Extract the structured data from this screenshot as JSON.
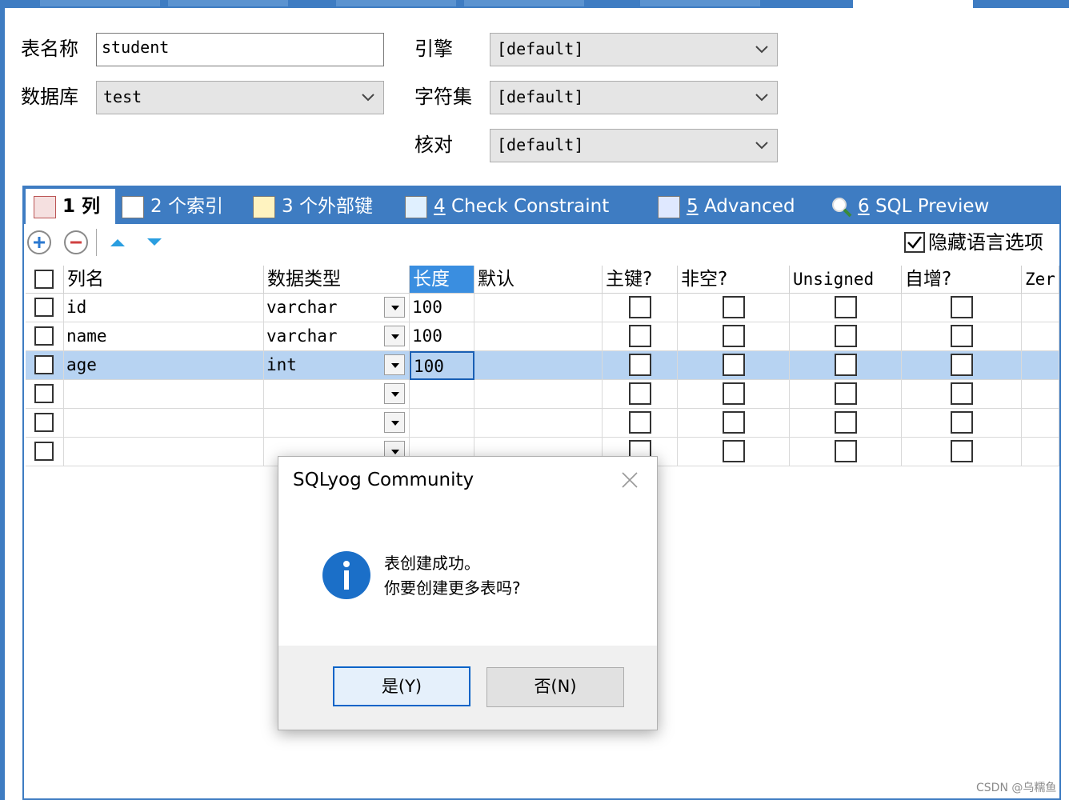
{
  "form": {
    "table_name_label": "表名称",
    "table_name_value": "student",
    "database_label": "数据库",
    "database_value": "test",
    "engine_label": "引擎",
    "engine_value": "[default]",
    "charset_label": "字符集",
    "charset_value": "[default]",
    "collation_label": "核对",
    "collation_value": "[default]"
  },
  "tabs": [
    {
      "num": "1",
      "label": "列"
    },
    {
      "num": "2",
      "label": "个索引"
    },
    {
      "num": "3",
      "label": "个外部键"
    },
    {
      "num": "4",
      "label": "Check Constraint"
    },
    {
      "num": "5",
      "label": "Advanced"
    },
    {
      "num": "6",
      "label": "SQL Preview"
    }
  ],
  "toolbar": {
    "hide_lang_label": "隐藏语言选项",
    "hide_lang_checked": true
  },
  "grid": {
    "headers": [
      "列名",
      "数据类型",
      "长度",
      "默认",
      "主键?",
      "非空?",
      "Unsigned",
      "自增?",
      "Zer"
    ],
    "rows": [
      {
        "name": "id",
        "type": "varchar",
        "length": "100"
      },
      {
        "name": "name",
        "type": "varchar",
        "length": "100"
      },
      {
        "name": "age",
        "type": "int",
        "length": "100"
      },
      {
        "name": "",
        "type": "",
        "length": ""
      },
      {
        "name": "",
        "type": "",
        "length": ""
      },
      {
        "name": "",
        "type": "",
        "length": ""
      }
    ]
  },
  "dialog": {
    "title": "SQLyog Community",
    "message_line1": "表创建成功。",
    "message_line2": "你要创建更多表吗?",
    "yes_label": "是(Y)",
    "no_label": "否(N)"
  },
  "watermark": "CSDN @乌糯鱼",
  "colors": {
    "accent": "#3e7cc2",
    "selected_row": "#b7d3f2",
    "info_icon": "#1b6fc8"
  }
}
